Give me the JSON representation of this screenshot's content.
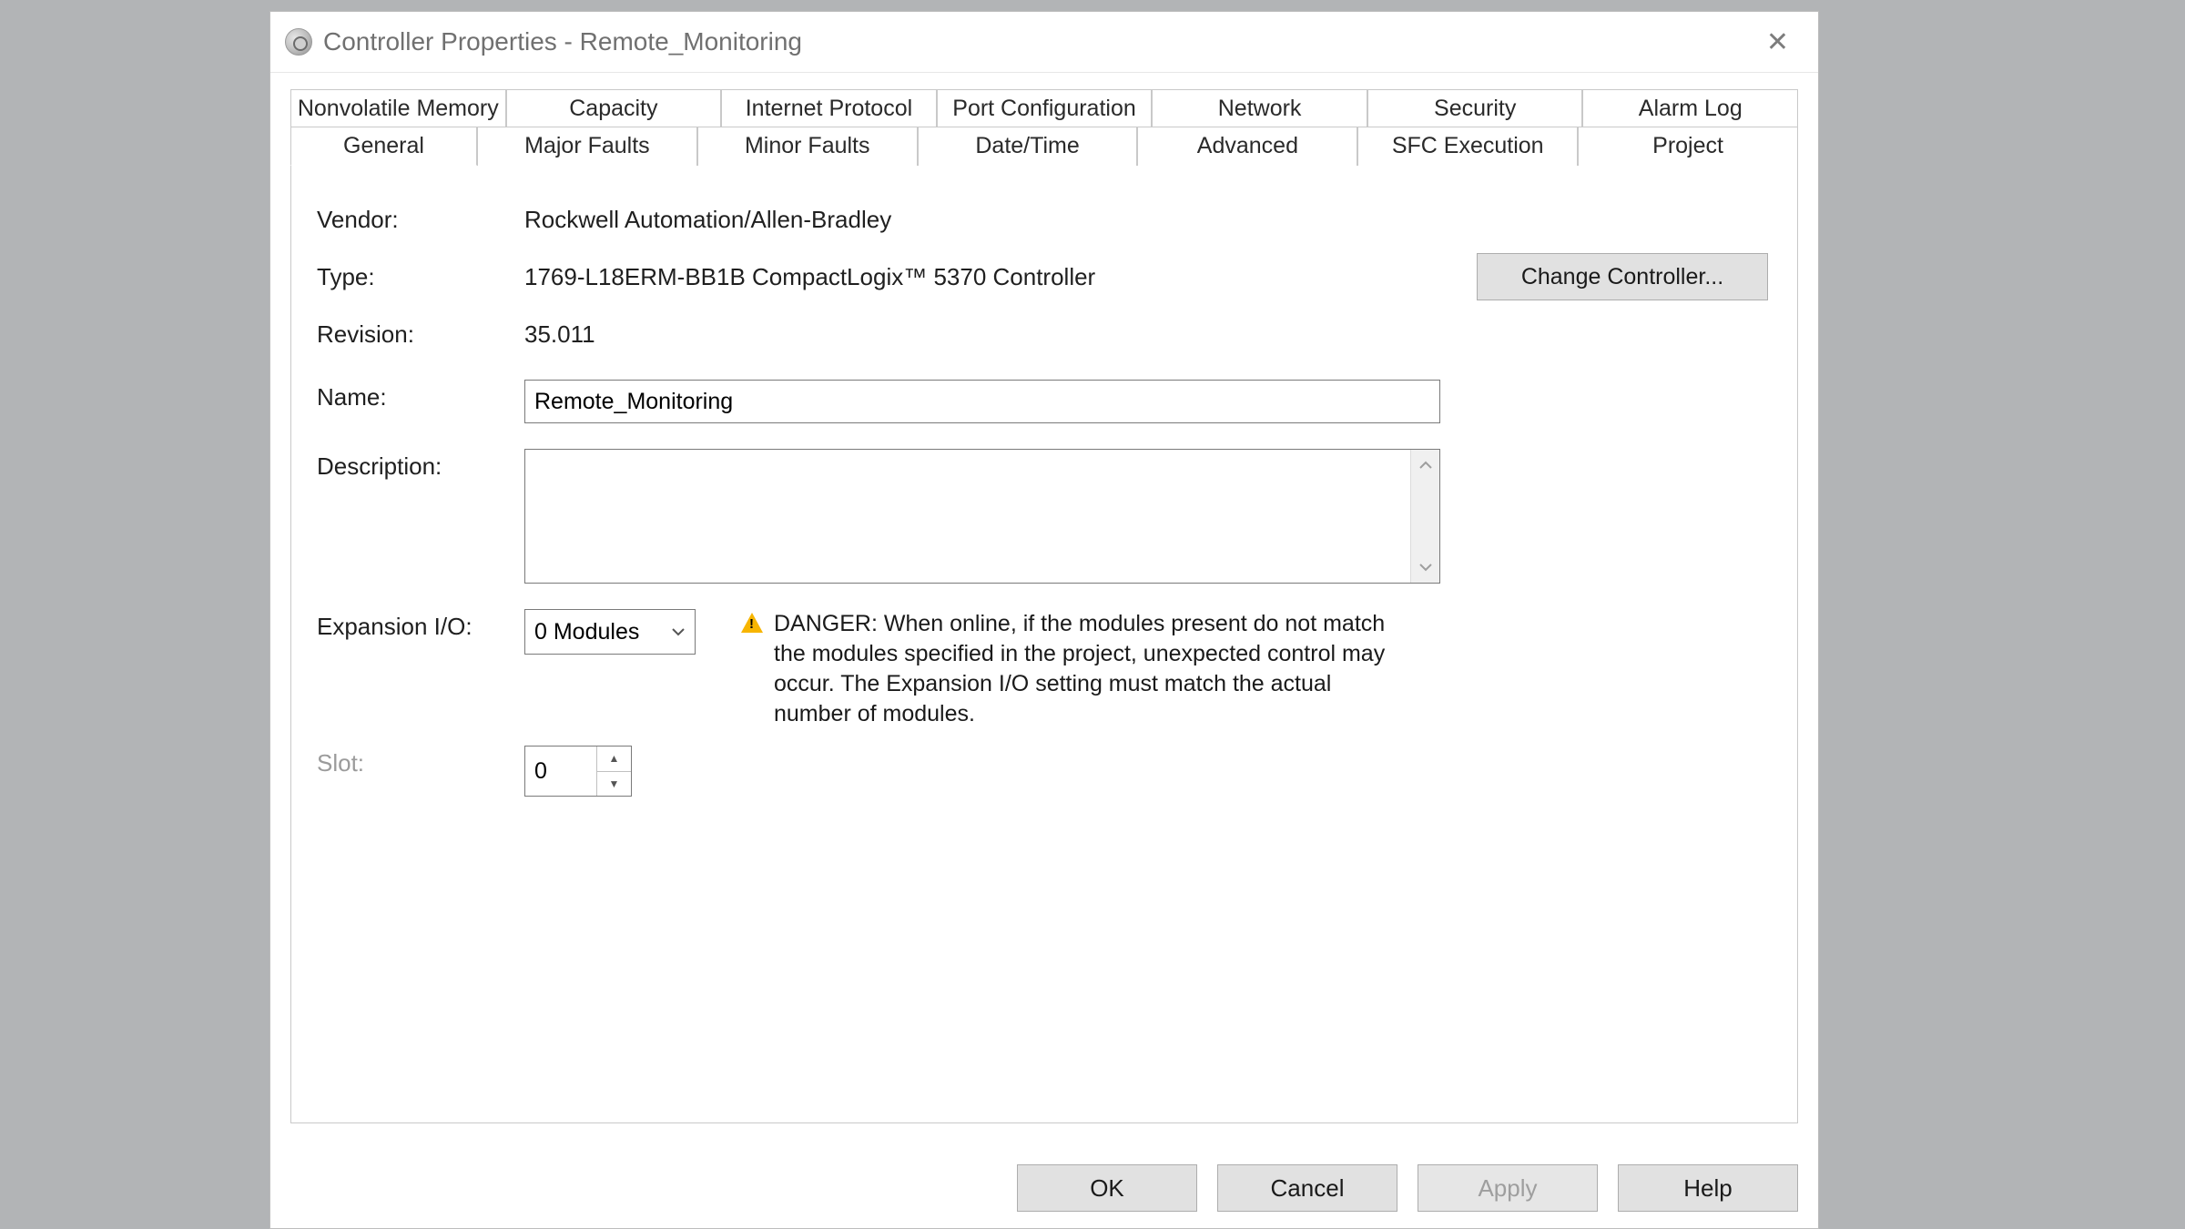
{
  "window": {
    "title": "Controller Properties - Remote_Monitoring"
  },
  "tabs": {
    "row_back": [
      "Nonvolatile Memory",
      "Capacity",
      "Internet Protocol",
      "Port Configuration",
      "Network",
      "Security",
      "Alarm Log"
    ],
    "row_front": [
      "General",
      "Major Faults",
      "Minor Faults",
      "Date/Time",
      "Advanced",
      "SFC Execution",
      "Project"
    ],
    "active": "General"
  },
  "general": {
    "labels": {
      "vendor": "Vendor:",
      "type": "Type:",
      "revision": "Revision:",
      "name": "Name:",
      "description": "Description:",
      "expansion_io": "Expansion I/O:",
      "slot": "Slot:"
    },
    "vendor": "Rockwell Automation/Allen-Bradley",
    "type": "1769-L18ERM-BB1B CompactLogix™ 5370 Controller",
    "revision": "35.011",
    "name_value": "Remote_Monitoring",
    "description_value": "",
    "expansion_io_value": "0 Modules",
    "slot_value": "0",
    "change_controller_label": "Change Controller...",
    "warning": "DANGER: When online, if the modules present do not match the modules specified in the project, unexpected control may occur. The Expansion I/O setting must match the actual number of modules."
  },
  "buttons": {
    "ok": "OK",
    "cancel": "Cancel",
    "apply": "Apply",
    "help": "Help"
  }
}
